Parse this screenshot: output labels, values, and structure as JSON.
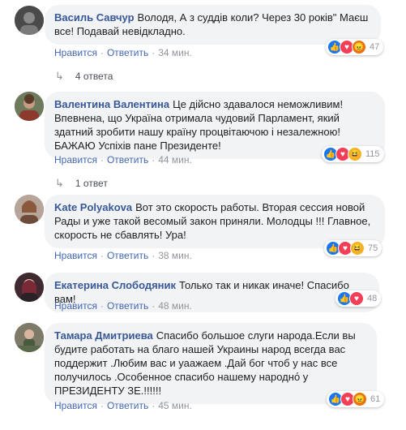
{
  "comments": [
    {
      "author": "Василь Савчур",
      "text": "Володя, А з суддів коли? Через 30 років\" Маєш все! Подавай невідкладно.",
      "like": "Нравится",
      "reply": "Ответить",
      "time": "34 мин.",
      "reaction_count": "47",
      "reactions": [
        "like-icon",
        "love-icon",
        "angry-icon"
      ],
      "replies": "4 ответа"
    },
    {
      "author": "Валентина Валентина",
      "text": "Це дійсно здавалося неможливим! Впевнена, що Україна отримала чудовий Парламент, який здатний зробити нашу країну процвітаючою і незалежною! БАЖАЮ Успіхів пане Президенте!",
      "like": "Нравится",
      "reply": "Ответить",
      "time": "44 мин.",
      "reaction_count": "115",
      "reactions": [
        "like-icon",
        "love-icon",
        "haha-icon"
      ],
      "replies": "1 ответ"
    },
    {
      "author": "Kate Polyakova",
      "text": "Вот это скорость работы. Вторая сессия новой Рады и уже такой весомый закон приняли. Молодцы !!! Главное, скорость не сбавлять! Ура!",
      "like": "Нравится",
      "reply": "Ответить",
      "time": "38 мин.",
      "reaction_count": "75",
      "reactions": [
        "like-icon",
        "love-icon",
        "haha-icon"
      ],
      "replies": ""
    },
    {
      "author": "Екатерина Слободяник",
      "text": "Только так и никак иначе! Спасибо вам!",
      "like": "Нравится",
      "reply": "Ответить",
      "time": "48 мин.",
      "reaction_count": "48",
      "reactions": [
        "like-icon",
        "love-icon"
      ],
      "replies": ""
    },
    {
      "author": "Тамара Дмитриева",
      "text": "Спасибо большое слуги народа.Если вы будите работать на благо нашей Украины народ всегда вас поддержит .Любим вас и уаажаем .Дай бог чтоб у нас все получилось .Особенное спасибо нашему народнό у ПРЕЗИДЕНТУ ЗЕ.!!!!!!",
      "like": "Нравится",
      "reply": "Ответить",
      "time": "45 мин.",
      "reaction_count": "61",
      "reactions": [
        "like-icon",
        "love-icon",
        "angry-icon"
      ],
      "replies": ""
    }
  ],
  "colors": {
    "author": "#385898",
    "link": "#4267b2",
    "bubble": "#f2f3f5",
    "like": "#1877f2",
    "love": "#f33e58",
    "haha": "#f7b125",
    "angry": "#e9710f"
  }
}
